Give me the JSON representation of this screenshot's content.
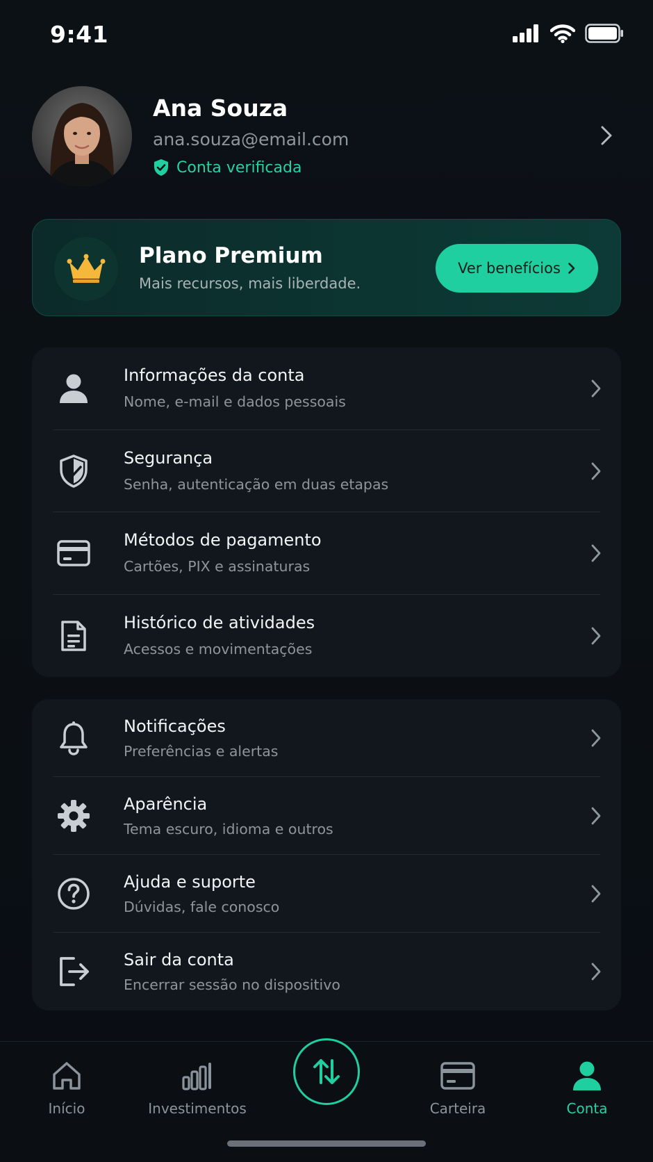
{
  "status_bar": {
    "time": "9:41",
    "icons": [
      "signal-icon",
      "wifi-icon",
      "battery-icon"
    ]
  },
  "profile": {
    "name": "Ana Souza",
    "email": "ana.souza@email.com",
    "verified_label": "Conta verificada"
  },
  "premium": {
    "title": "Plano Premium",
    "subtitle": "Mais recursos, mais liberdade.",
    "button_label": "Ver benefícios"
  },
  "account_section": {
    "items": [
      {
        "title": "Informações da conta",
        "subtitle": "Nome, e-mail e dados pessoais",
        "icon": "user-icon"
      },
      {
        "title": "Segurança",
        "subtitle": "Senha, autenticação em duas etapas",
        "icon": "shield-icon"
      },
      {
        "title": "Métodos de pagamento",
        "subtitle": "Cartões, PIX e assinaturas",
        "icon": "credit-card-icon"
      },
      {
        "title": "Histórico de atividades",
        "subtitle": "Acessos e movimentações",
        "icon": "document-icon"
      }
    ]
  },
  "settings_section": {
    "items": [
      {
        "title": "Notificações",
        "subtitle": "Preferências e alertas",
        "icon": "bell-icon"
      },
      {
        "title": "Aparência",
        "subtitle": "Tema escuro, idioma e outros",
        "icon": "gear-icon"
      },
      {
        "title": "Ajuda e suporte",
        "subtitle": "Dúvidas, fale conosco",
        "icon": "help-icon"
      },
      {
        "title": "Sair da conta",
        "subtitle": "Encerrar sessão no dispositivo",
        "icon": "logout-icon"
      }
    ]
  },
  "tabbar": {
    "tabs": [
      {
        "label": "Início",
        "icon": "home-icon",
        "active": false
      },
      {
        "label": "Investimentos",
        "icon": "bar-chart-icon",
        "active": false
      },
      {
        "label": "Carteira",
        "icon": "wallet-card-icon",
        "active": false
      },
      {
        "label": "Conta",
        "icon": "user-icon",
        "active": true
      }
    ],
    "center_action_icon": "transfer-arrows-icon"
  },
  "colors": {
    "background": "#0b1015",
    "card": "#12171d",
    "accent": "#1fcf9f",
    "accent_text": "#22d3a6",
    "crown": "#f5b83a",
    "muted_text": "#8d959c"
  }
}
